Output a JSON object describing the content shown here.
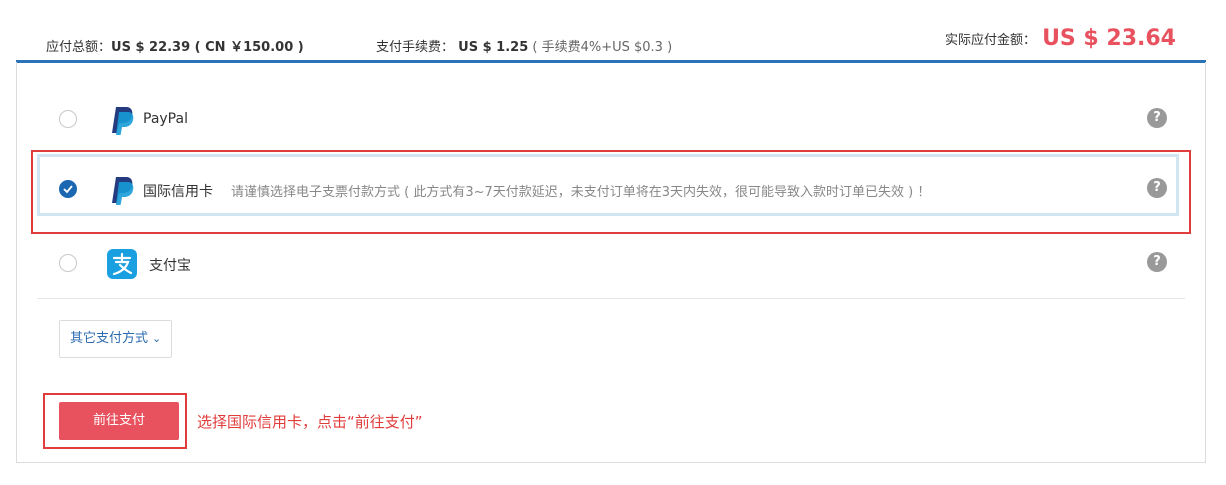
{
  "summary": {
    "total_label": "应付总额：",
    "total_value": "US $ 22.39 ( CN ￥150.00 )",
    "fee_label": "支付手续费：",
    "fee_value": "US $ 1.25",
    "fee_note": "( 手续费4%+US $0.3 )",
    "actual_label": "实际应付金额：",
    "actual_value": "US $ 23.64"
  },
  "methods": [
    {
      "name": "PayPal",
      "note": "",
      "selected": false,
      "icon": "paypal-icon"
    },
    {
      "name": "国际信用卡",
      "note": "请谨慎选择电子支票付款方式 ( 此方式有3~7天付款延迟，未支付订单将在3天内失效，很可能导致入款时订单已失效 ) ！",
      "selected": true,
      "icon": "paypal-icon"
    },
    {
      "name": "支付宝",
      "note": "",
      "selected": false,
      "icon": "alipay-icon"
    }
  ],
  "help_glyph": "?",
  "other_methods_label": "其它支付方式",
  "pay_button_label": "前往支付",
  "annotation_hint": "选择国际信用卡，点击“前往支付”",
  "colors": {
    "accent_blue": "#2b73b8",
    "price_red": "#e8515e",
    "highlight_red": "#e03c3c",
    "paypal_dark": "#253b80",
    "paypal_light": "#179bd7",
    "alipay_blue": "#1a9fe0"
  }
}
